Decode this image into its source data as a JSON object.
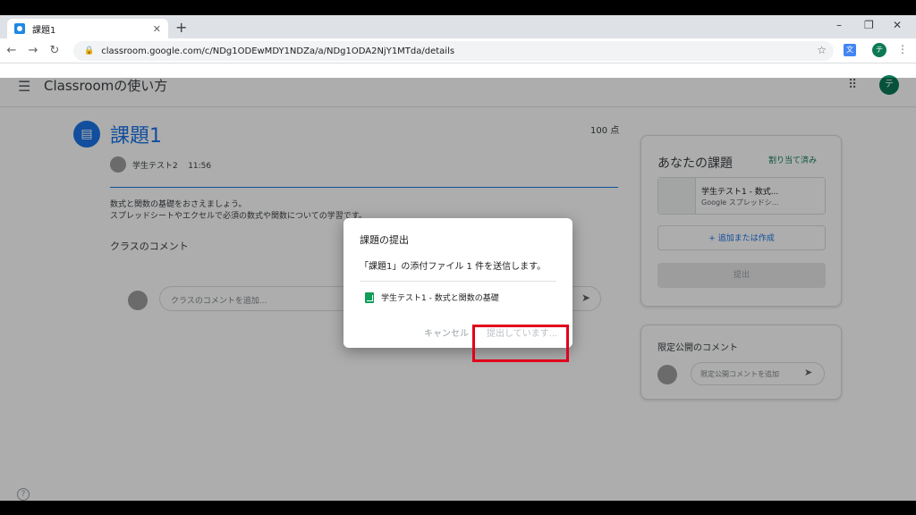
{
  "browser": {
    "tab_title": "課題1",
    "tab_close": "✕",
    "new_tab": "+",
    "url": "classroom.google.com/c/NDg1ODEwMDY1NDZa/a/NDg1ODA2NjY1MTda/details",
    "win_min": "–",
    "win_max": "❐",
    "win_close": "✕",
    "profile_initial": "テ"
  },
  "app": {
    "title": "Classroomの使い方",
    "user_initial": "テ"
  },
  "assignment": {
    "title": "課題1",
    "points": "100 点",
    "author": "学生テスト2",
    "time": "11:56",
    "description_line1": "数式と関数の基礎をおさえましょう。",
    "description_line2": "スプレッドシートやエクセルで必須の数式や関数についての学習です。",
    "class_comments_label": "クラスのコメント",
    "class_comment_placeholder": "クラスのコメントを追加..."
  },
  "your_work": {
    "title": "あなたの課題",
    "status": "割り当て済み",
    "file_name": "学生テスト1 - 数式...",
    "file_type": "Google スプレッドシ...",
    "add_label": "+ 追加または作成",
    "submit_label": "提出"
  },
  "private_comments": {
    "title": "限定公開のコメント",
    "placeholder": "限定公開コメントを追加"
  },
  "dialog": {
    "title": "課題の提出",
    "message": "「課題1」の添付ファイル 1 件を送信します。",
    "file": "学生テスト1 - 数式と関数の基礎",
    "cancel": "キャンセル",
    "submitting": "提出しています..."
  },
  "colors": {
    "accent": "#1a73e8",
    "highlight": "#e0001b",
    "sheets": "#0f9d58",
    "avatar": "#0d7a57"
  }
}
